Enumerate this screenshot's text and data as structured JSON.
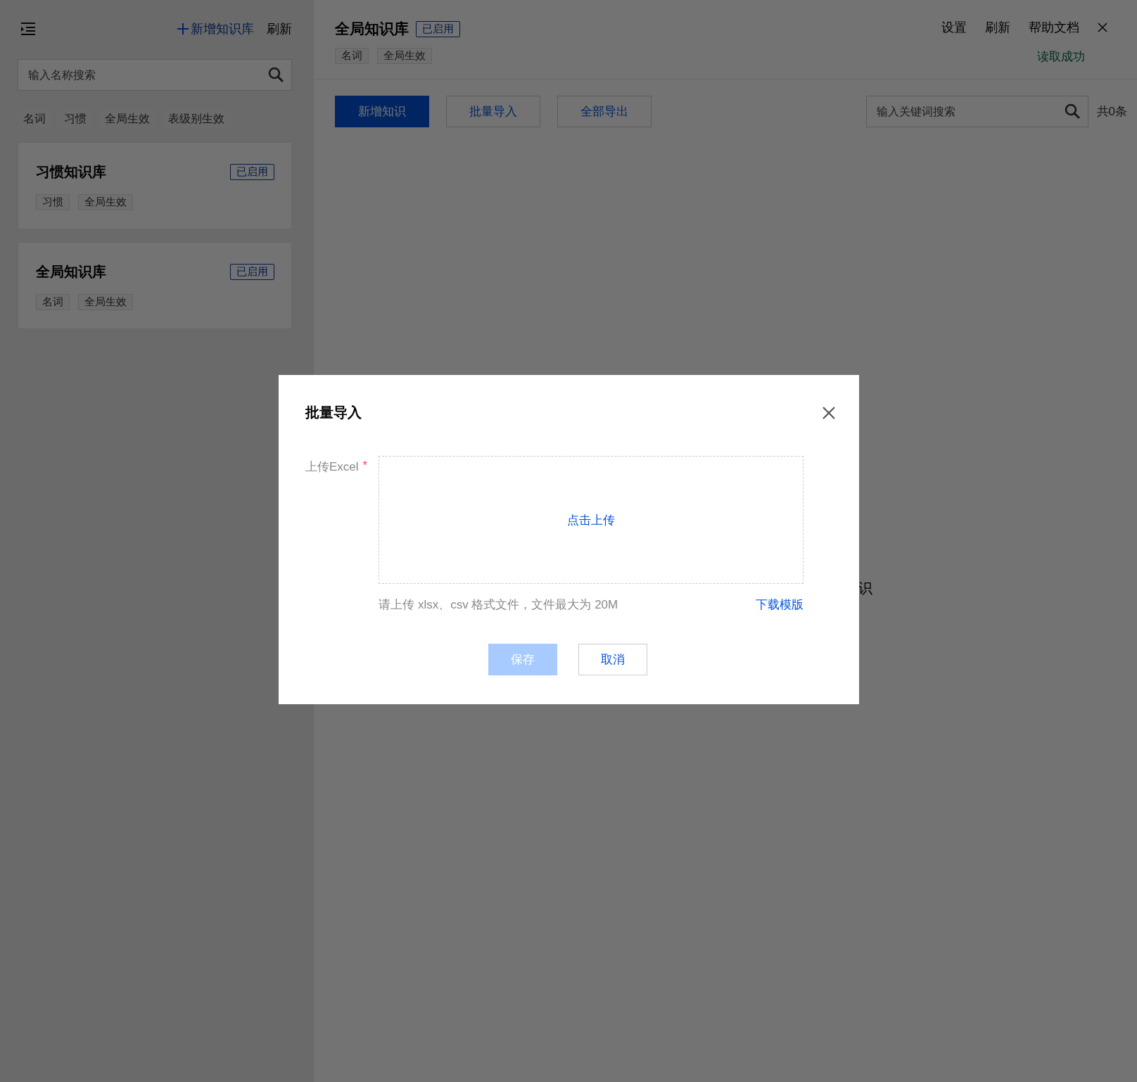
{
  "sidebar": {
    "add_button": "新增知识库",
    "refresh_button": "刷新",
    "search": {
      "placeholder": "输入名称搜索"
    },
    "filters": [
      "名词",
      "习惯",
      "全局生效",
      "表级别生效"
    ],
    "cards": [
      {
        "title": "习惯知识库",
        "status": "已启用",
        "tags": [
          "习惯",
          "全局生效"
        ]
      },
      {
        "title": "全局知识库",
        "status": "已启用",
        "tags": [
          "名词",
          "全局生效"
        ]
      }
    ]
  },
  "main": {
    "title": "全局知识库",
    "status": "已启用",
    "tags": [
      "名词",
      "全局生效"
    ],
    "actions": [
      "设置",
      "刷新",
      "帮助文档"
    ],
    "message": "读取成功",
    "toolbar": {
      "buttons": [
        {
          "label": "新增知识",
          "kind": "primary"
        },
        {
          "label": "批量导入",
          "kind": "default"
        },
        {
          "label": "全部导出",
          "kind": "default"
        }
      ],
      "search": {
        "placeholder": "输入关键词搜索"
      },
      "count": "共0条"
    },
    "empty_text": "识"
  },
  "dialog": {
    "title": "批量导入",
    "field_label": "上传Excel",
    "required_mark": "*",
    "upload_link": "点击上传",
    "hint": "请上传 xlsx、csv 格式文件，文件最大为 20M",
    "template_link": "下载模版",
    "buttons": [
      {
        "label": "保存",
        "kind": "primary",
        "disabled": true
      },
      {
        "label": "取消",
        "kind": "default",
        "disabled": false
      }
    ]
  }
}
